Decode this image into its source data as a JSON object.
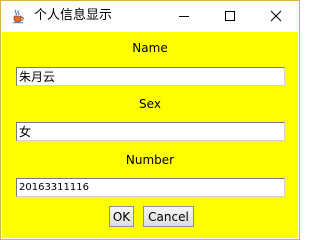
{
  "window": {
    "title": "个人信息显示",
    "controls": {
      "minimize_icon": "minimize-icon",
      "maximize_icon": "maximize-icon",
      "close_icon": "close-icon"
    },
    "app_icon": "java-cup-icon"
  },
  "form": {
    "name": {
      "label": "Name",
      "value": "朱月云"
    },
    "sex": {
      "label": "Sex",
      "value": "女"
    },
    "number": {
      "label": "Number",
      "value": "20163311116"
    }
  },
  "buttons": {
    "ok_label": "OK",
    "cancel_label": "Cancel"
  },
  "colors": {
    "content_background": "#ffff00",
    "window_border": "#d9b24a"
  }
}
